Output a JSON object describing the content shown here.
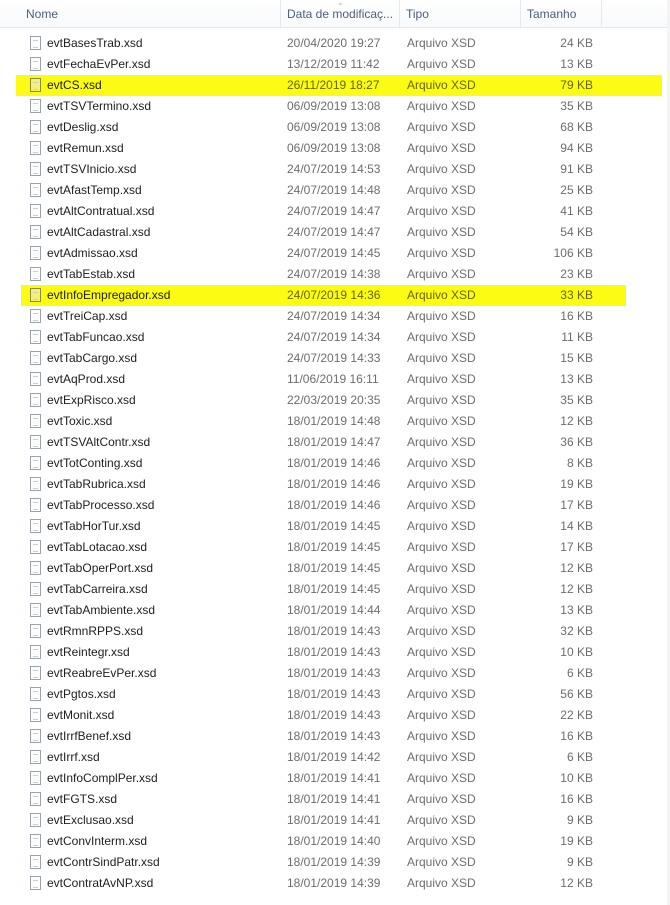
{
  "columns": {
    "name": "Nome",
    "date": "Data de modificaç...",
    "type": "Tipo",
    "size": "Tamanho"
  },
  "colors": {
    "highlight": "#fbfb14",
    "header_text": "#4c607a"
  },
  "icons": {
    "file": "xsd-file-icon",
    "sort": "sort-arrow-icon"
  },
  "files": [
    {
      "name": "evtBasesTrab.xsd",
      "date": "20/04/2020 19:27",
      "type": "Arquivo XSD",
      "size": "24 KB"
    },
    {
      "name": "evtFechaEvPer.xsd",
      "date": "13/12/2019 11:42",
      "type": "Arquivo XSD",
      "size": "13 KB"
    },
    {
      "name": "evtCS.xsd",
      "date": "26/11/2019 18:27",
      "type": "Arquivo XSD",
      "size": "79 KB",
      "highlighted": true
    },
    {
      "name": "evtTSVTermino.xsd",
      "date": "06/09/2019 13:08",
      "type": "Arquivo XSD",
      "size": "35 KB"
    },
    {
      "name": "evtDeslig.xsd",
      "date": "06/09/2019 13:08",
      "type": "Arquivo XSD",
      "size": "68 KB"
    },
    {
      "name": "evtRemun.xsd",
      "date": "06/09/2019 13:08",
      "type": "Arquivo XSD",
      "size": "94 KB"
    },
    {
      "name": "evtTSVInicio.xsd",
      "date": "24/07/2019 14:53",
      "type": "Arquivo XSD",
      "size": "91 KB"
    },
    {
      "name": "evtAfastTemp.xsd",
      "date": "24/07/2019 14:48",
      "type": "Arquivo XSD",
      "size": "25 KB"
    },
    {
      "name": "evtAltContratual.xsd",
      "date": "24/07/2019 14:47",
      "type": "Arquivo XSD",
      "size": "41 KB"
    },
    {
      "name": "evtAltCadastral.xsd",
      "date": "24/07/2019 14:47",
      "type": "Arquivo XSD",
      "size": "54 KB"
    },
    {
      "name": "evtAdmissao.xsd",
      "date": "24/07/2019 14:45",
      "type": "Arquivo XSD",
      "size": "106 KB"
    },
    {
      "name": "evtTabEstab.xsd",
      "date": "24/07/2019 14:38",
      "type": "Arquivo XSD",
      "size": "23 KB"
    },
    {
      "name": "evtInfoEmpregador.xsd",
      "date": "24/07/2019 14:36",
      "type": "Arquivo XSD",
      "size": "33 KB",
      "highlighted": true
    },
    {
      "name": "evtTreiCap.xsd",
      "date": "24/07/2019 14:34",
      "type": "Arquivo XSD",
      "size": "16 KB"
    },
    {
      "name": "evtTabFuncao.xsd",
      "date": "24/07/2019 14:34",
      "type": "Arquivo XSD",
      "size": "11 KB"
    },
    {
      "name": "evtTabCargo.xsd",
      "date": "24/07/2019 14:33",
      "type": "Arquivo XSD",
      "size": "15 KB"
    },
    {
      "name": "evtAqProd.xsd",
      "date": "11/06/2019 16:11",
      "type": "Arquivo XSD",
      "size": "13 KB"
    },
    {
      "name": "evtExpRisco.xsd",
      "date": "22/03/2019 20:35",
      "type": "Arquivo XSD",
      "size": "35 KB"
    },
    {
      "name": "evtToxic.xsd",
      "date": "18/01/2019 14:48",
      "type": "Arquivo XSD",
      "size": "12 KB"
    },
    {
      "name": "evtTSVAltContr.xsd",
      "date": "18/01/2019 14:47",
      "type": "Arquivo XSD",
      "size": "36 KB"
    },
    {
      "name": "evtTotConting.xsd",
      "date": "18/01/2019 14:46",
      "type": "Arquivo XSD",
      "size": "8 KB"
    },
    {
      "name": "evtTabRubrica.xsd",
      "date": "18/01/2019 14:46",
      "type": "Arquivo XSD",
      "size": "19 KB"
    },
    {
      "name": "evtTabProcesso.xsd",
      "date": "18/01/2019 14:46",
      "type": "Arquivo XSD",
      "size": "17 KB"
    },
    {
      "name": "evtTabHorTur.xsd",
      "date": "18/01/2019 14:45",
      "type": "Arquivo XSD",
      "size": "14 KB"
    },
    {
      "name": "evtTabLotacao.xsd",
      "date": "18/01/2019 14:45",
      "type": "Arquivo XSD",
      "size": "17 KB"
    },
    {
      "name": "evtTabOperPort.xsd",
      "date": "18/01/2019 14:45",
      "type": "Arquivo XSD",
      "size": "12 KB"
    },
    {
      "name": "evtTabCarreira.xsd",
      "date": "18/01/2019 14:45",
      "type": "Arquivo XSD",
      "size": "12 KB"
    },
    {
      "name": "evtTabAmbiente.xsd",
      "date": "18/01/2019 14:44",
      "type": "Arquivo XSD",
      "size": "13 KB"
    },
    {
      "name": "evtRmnRPPS.xsd",
      "date": "18/01/2019 14:43",
      "type": "Arquivo XSD",
      "size": "32 KB"
    },
    {
      "name": "evtReintegr.xsd",
      "date": "18/01/2019 14:43",
      "type": "Arquivo XSD",
      "size": "10 KB"
    },
    {
      "name": "evtReabreEvPer.xsd",
      "date": "18/01/2019 14:43",
      "type": "Arquivo XSD",
      "size": "6 KB"
    },
    {
      "name": "evtPgtos.xsd",
      "date": "18/01/2019 14:43",
      "type": "Arquivo XSD",
      "size": "56 KB"
    },
    {
      "name": "evtMonit.xsd",
      "date": "18/01/2019 14:43",
      "type": "Arquivo XSD",
      "size": "22 KB"
    },
    {
      "name": "evtIrrfBenef.xsd",
      "date": "18/01/2019 14:43",
      "type": "Arquivo XSD",
      "size": "16 KB"
    },
    {
      "name": "evtIrrf.xsd",
      "date": "18/01/2019 14:42",
      "type": "Arquivo XSD",
      "size": "6 KB"
    },
    {
      "name": "evtInfoComplPer.xsd",
      "date": "18/01/2019 14:41",
      "type": "Arquivo XSD",
      "size": "10 KB"
    },
    {
      "name": "evtFGTS.xsd",
      "date": "18/01/2019 14:41",
      "type": "Arquivo XSD",
      "size": "16 KB"
    },
    {
      "name": "evtExclusao.xsd",
      "date": "18/01/2019 14:41",
      "type": "Arquivo XSD",
      "size": "9 KB"
    },
    {
      "name": "evtConvInterm.xsd",
      "date": "18/01/2019 14:40",
      "type": "Arquivo XSD",
      "size": "19 KB"
    },
    {
      "name": "evtContrSindPatr.xsd",
      "date": "18/01/2019 14:39",
      "type": "Arquivo XSD",
      "size": "9 KB"
    },
    {
      "name": "evtContratAvNP.xsd",
      "date": "18/01/2019 14:39",
      "type": "Arquivo XSD",
      "size": "12 KB"
    }
  ]
}
